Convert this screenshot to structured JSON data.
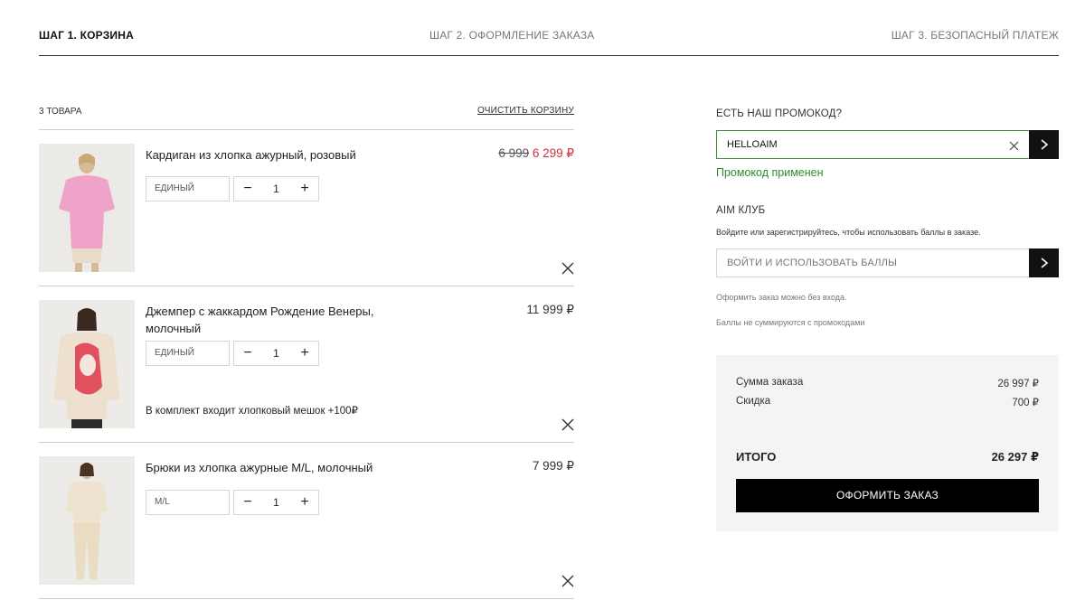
{
  "steps": {
    "step1": "ШАГ 1. КОРЗИНА",
    "step2": "ШАГ 2. ОФОРМЛЕНИЕ ЗАКАЗА",
    "step3": "ШАГ 3. БЕЗОПАСНЫЙ ПЛАТЕЖ"
  },
  "cart": {
    "count": "3 ТОВАРА",
    "clear_label": "ОЧИСТИТЬ КОРЗИНУ",
    "items": [
      {
        "title": "Кардиган из хлопка ажурный, розовый",
        "price_old": "6 999",
        "price_new": "6 299 ₽",
        "size": "ЕДИНЫЙ",
        "qty": "1",
        "minus": "−",
        "plus": "+"
      },
      {
        "title": "Джемпер с жаккардом Рождение Венеры, молочный",
        "price": "11 999 ₽",
        "size": "ЕДИНЫЙ",
        "qty": "1",
        "minus": "−",
        "plus": "+",
        "note": "В комплект входит хлопковый мешок +100₽"
      },
      {
        "title": "Брюки из хлопка ажурные M/L, молочный",
        "price": "7 999 ₽",
        "size": "M/L",
        "qty": "1",
        "minus": "−",
        "plus": "+"
      }
    ]
  },
  "promo": {
    "label": "ЕСТЬ НАШ ПРОМОКОД?",
    "value": "HELLOAIM",
    "status": "Промокод применен"
  },
  "club": {
    "label": "AIM КЛУБ",
    "description": "Войдите или зарегистрируйтесь, чтобы использовать баллы в заказе.",
    "points_placeholder": "ВОЙТИ И ИСПОЛЬЗОВАТЬ БАЛЛЫ",
    "note1": "Оформить заказ можно без входа.",
    "note2": "Баллы не суммируются с промокодами"
  },
  "summary": {
    "sum_label": "Сумма заказа",
    "sum_value": "26 997 ₽",
    "discount_label": "Скидка",
    "discount_value": "700 ₽",
    "total_label": "ИТОГО",
    "total_value": "26 297 ₽",
    "checkout_label": "ОФОРМИТЬ ЗАКАЗ"
  },
  "icons": {
    "remove": "close-icon",
    "arrow": "chevron-right-icon"
  },
  "colors": {
    "sale_price": "#d0343a",
    "promo_success": "#2e8b2e",
    "button": "#000000"
  }
}
